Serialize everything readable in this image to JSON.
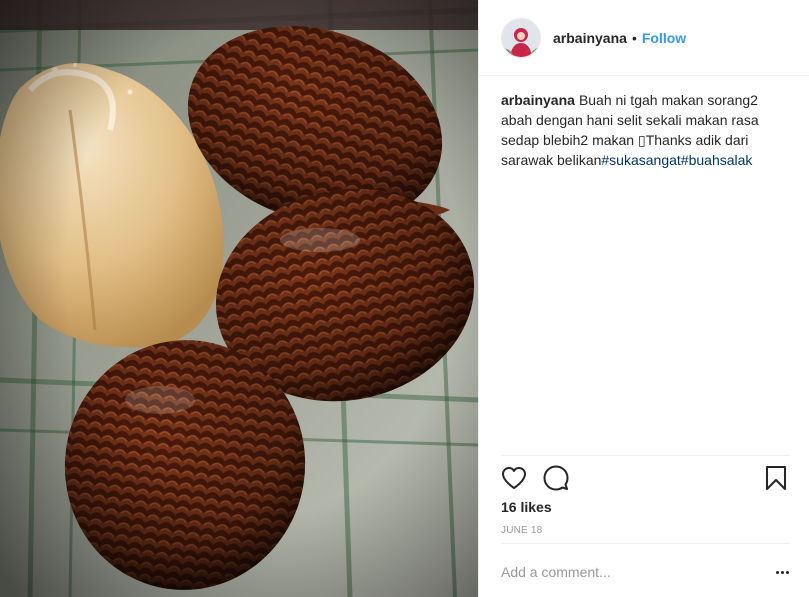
{
  "post": {
    "username": "arbainyana",
    "separator": "•",
    "follow_label": "Follow",
    "caption_user": "arbainyana",
    "caption_text": "Buah ni tgah makan sorang2 abah dengan hani selit sekali makan rasa sedap blebih2 makan ▯Thanks adik dari sarawak belikan",
    "hashtags": [
      "#sukasangat",
      "#buahsalak"
    ],
    "likes": "16 likes",
    "date": "JUNE 18",
    "comment_placeholder": "Add a comment..."
  },
  "icons": {
    "like": "heart-icon",
    "comment": "speech-bubble-icon",
    "save": "bookmark-icon",
    "more": "more-options-icon"
  },
  "colors": {
    "link": "#3897f0",
    "hashtag": "#003569",
    "text": "#262626",
    "muted": "#999999",
    "border": "#efefef"
  }
}
